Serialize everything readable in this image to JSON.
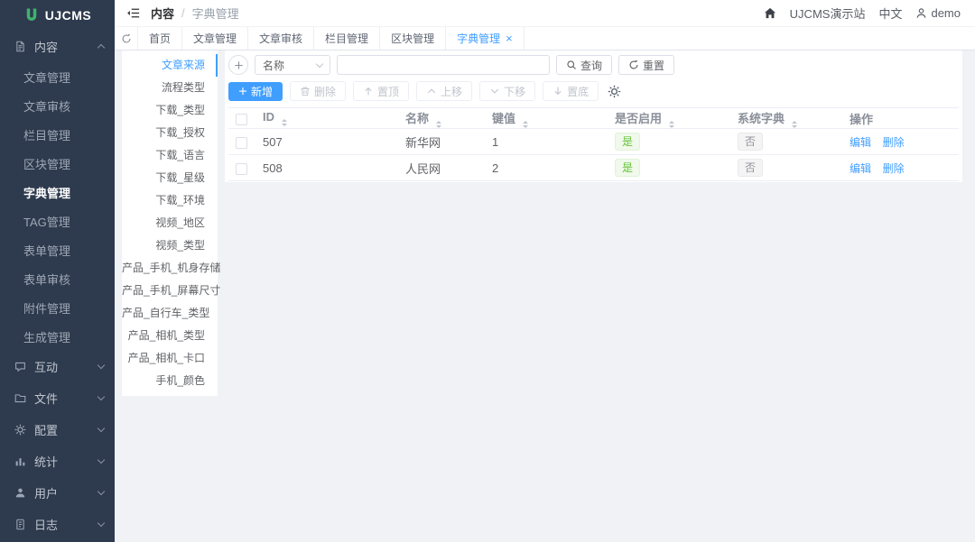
{
  "brand": {
    "name": "UJCMS"
  },
  "header": {
    "breadcrumb": {
      "menu": "内容",
      "separator": "/",
      "page": "字典管理"
    },
    "site_name": "UJCMS演示站",
    "language": "中文",
    "username": "demo"
  },
  "sidebar": {
    "entries": [
      {
        "type": "group",
        "label": "内容",
        "icon": "document-icon",
        "chevron_up": true
      },
      {
        "type": "item",
        "label": "文章管理"
      },
      {
        "type": "item",
        "label": "文章审核"
      },
      {
        "type": "item",
        "label": "栏目管理"
      },
      {
        "type": "item",
        "label": "区块管理"
      },
      {
        "type": "item",
        "label": "字典管理",
        "active": true
      },
      {
        "type": "item",
        "label": "TAG管理"
      },
      {
        "type": "item",
        "label": "表单管理"
      },
      {
        "type": "item",
        "label": "表单审核"
      },
      {
        "type": "item",
        "label": "附件管理"
      },
      {
        "type": "item",
        "label": "生成管理"
      },
      {
        "type": "group",
        "label": "互动",
        "icon": "chat-icon",
        "chevron_down": true
      },
      {
        "type": "group",
        "label": "文件",
        "icon": "folder-icon",
        "chevron_down": true
      },
      {
        "type": "group",
        "label": "配置",
        "icon": "gear-icon",
        "chevron_down": true
      },
      {
        "type": "group",
        "label": "统计",
        "icon": "chart-icon",
        "chevron_down": true
      },
      {
        "type": "group",
        "label": "用户",
        "icon": "user-icon",
        "chevron_down": true
      },
      {
        "type": "group",
        "label": "日志",
        "icon": "log-icon",
        "chevron_down": true
      }
    ]
  },
  "tabs": {
    "items": [
      {
        "label": "首页"
      },
      {
        "label": "文章管理"
      },
      {
        "label": "文章审核"
      },
      {
        "label": "栏目管理"
      },
      {
        "label": "区块管理"
      },
      {
        "label": "字典管理",
        "active": true,
        "closable": true
      }
    ]
  },
  "dict_types": {
    "items": [
      {
        "label": "文章来源",
        "active": true
      },
      {
        "label": "流程类型"
      },
      {
        "label": "下载_类型"
      },
      {
        "label": "下载_授权"
      },
      {
        "label": "下载_语言"
      },
      {
        "label": "下载_星级"
      },
      {
        "label": "下载_环境"
      },
      {
        "label": "视频_地区"
      },
      {
        "label": "视频_类型"
      },
      {
        "label": "产品_手机_机身存储"
      },
      {
        "label": "产品_手机_屏幕尺寸"
      },
      {
        "label": "产品_自行车_类型"
      },
      {
        "label": "产品_相机_类型"
      },
      {
        "label": "产品_相机_卡口"
      },
      {
        "label": "手机_颜色"
      }
    ]
  },
  "toolbar": {
    "filter_field": "名称",
    "search_value": "",
    "query_label": "查询",
    "reset_label": "重置",
    "add_label": "新增",
    "delete_label": "删除",
    "top_label": "置顶",
    "up_label": "上移",
    "down_label": "下移",
    "bottom_label": "置底"
  },
  "table": {
    "columns": [
      {
        "label": "ID",
        "sortable": true
      },
      {
        "label": "名称",
        "sortable": true
      },
      {
        "label": "键值",
        "sortable": true
      },
      {
        "label": "是否启用",
        "sortable": true
      },
      {
        "label": "系统字典",
        "sortable": true
      },
      {
        "label": "操作"
      }
    ],
    "rows": [
      {
        "id": "507",
        "name": "新华网",
        "value": "1",
        "enabled": {
          "text": "是",
          "variant": "success"
        },
        "system": {
          "text": "否",
          "variant": "info"
        }
      },
      {
        "id": "508",
        "name": "人民网",
        "value": "2",
        "enabled": {
          "text": "是",
          "variant": "success"
        },
        "system": {
          "text": "否",
          "variant": "info"
        }
      }
    ],
    "edit_label": "编辑",
    "delete_label": "删除"
  },
  "colors": {
    "primary": "#409eff",
    "success": "#67c23a",
    "success_bg": "#f0f9eb",
    "info": "#909399",
    "info_bg": "#f4f4f5",
    "sidebar_bg": "#2e3a4d",
    "logo_green": "#3eb36e",
    "page_bg": "#f0f2f5"
  }
}
